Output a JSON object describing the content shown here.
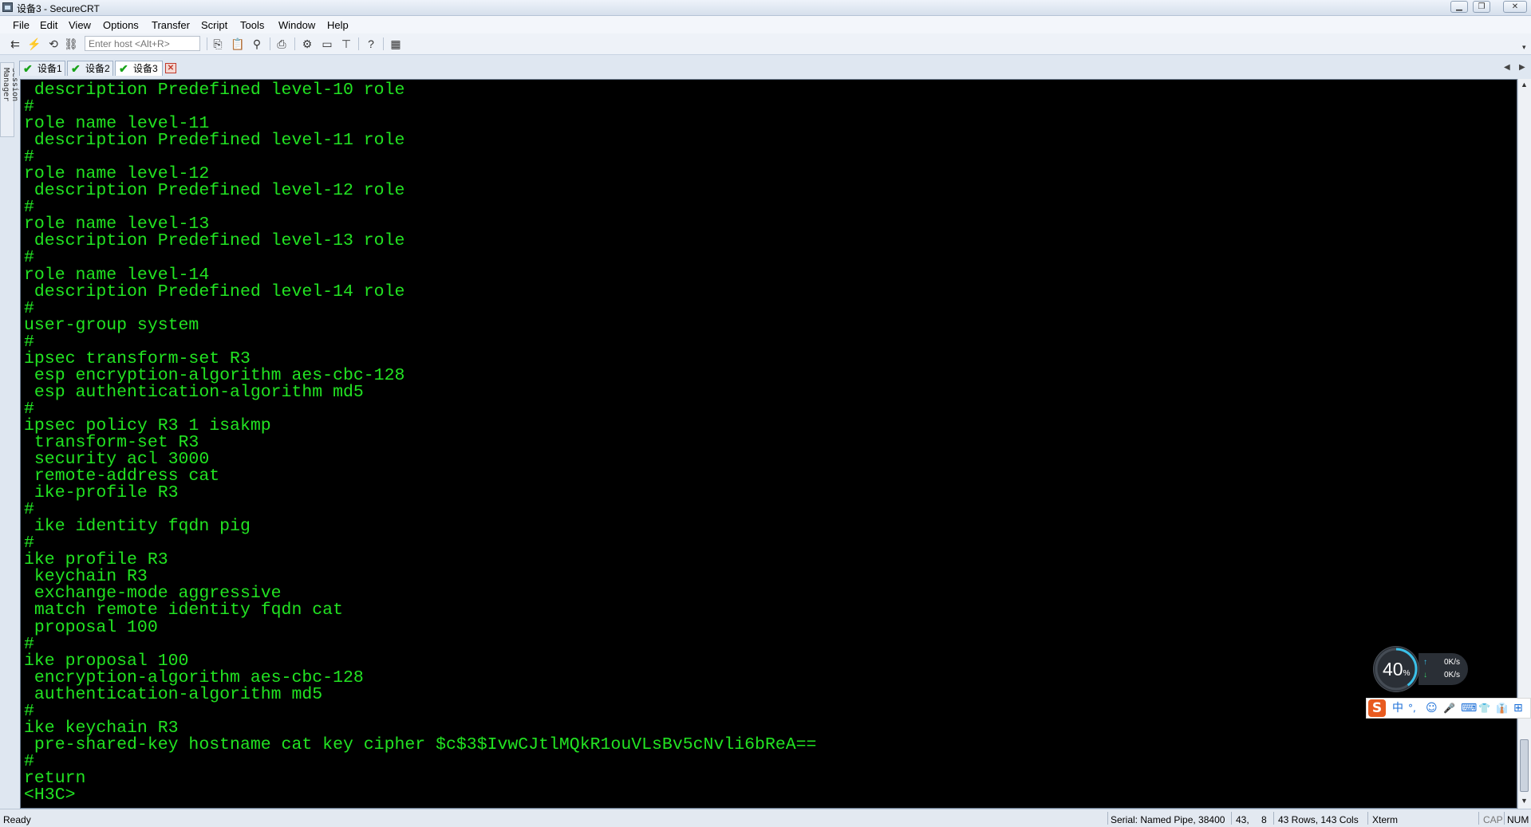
{
  "window": {
    "title": "设备3 - SecureCRT"
  },
  "menu": [
    "File",
    "Edit",
    "View",
    "Options",
    "Transfer",
    "Script",
    "Tools",
    "Window",
    "Help"
  ],
  "toolbar": {
    "host_placeholder": "Enter host <Alt+R>"
  },
  "session_manager": {
    "label": "Session Manager"
  },
  "tabs": [
    {
      "label": "设备1",
      "active": false
    },
    {
      "label": "设备2",
      "active": false
    },
    {
      "label": "设备3",
      "active": true
    }
  ],
  "terminal": {
    "lines": [
      " description Predefined level-10 role",
      "#",
      "role name level-11",
      " description Predefined level-11 role",
      "#",
      "role name level-12",
      " description Predefined level-12 role",
      "#",
      "role name level-13",
      " description Predefined level-13 role",
      "#",
      "role name level-14",
      " description Predefined level-14 role",
      "#",
      "user-group system",
      "#",
      "ipsec transform-set R3",
      " esp encryption-algorithm aes-cbc-128",
      " esp authentication-algorithm md5",
      "#",
      "ipsec policy R3 1 isakmp",
      " transform-set R3",
      " security acl 3000",
      " remote-address cat",
      " ike-profile R3",
      "#",
      " ike identity fqdn pig",
      "#",
      "ike profile R3",
      " keychain R3",
      " exchange-mode aggressive",
      " match remote identity fqdn cat",
      " proposal 100",
      "#",
      "ike proposal 100",
      " encryption-algorithm aes-cbc-128",
      " authentication-algorithm md5",
      "#",
      "ike keychain R3",
      " pre-shared-key hostname cat key cipher $c$3$IvwCJtlMQkR1ouVLsBv5cNvli6bReA==",
      "#",
      "return",
      "<H3C>"
    ],
    "text_color": "#22e322",
    "background": "#000000"
  },
  "speed_widget": {
    "percent": "40",
    "percent_unit": "%",
    "up": "0K/s",
    "down": "0K/s",
    "ring_fraction": 0.4
  },
  "ime": {
    "logo": "S",
    "items": [
      "中",
      "°,",
      "☺",
      "🎤",
      "⌨",
      "👕",
      "👔",
      "⊞"
    ]
  },
  "status": {
    "ready": "Ready",
    "serial": "Serial: Named Pipe, 38400",
    "cursor_row": "43,",
    "cursor_col": "8",
    "dims": "43 Rows, 143 Cols",
    "term": "Xterm",
    "cap": "CAP",
    "num": "NUM"
  }
}
